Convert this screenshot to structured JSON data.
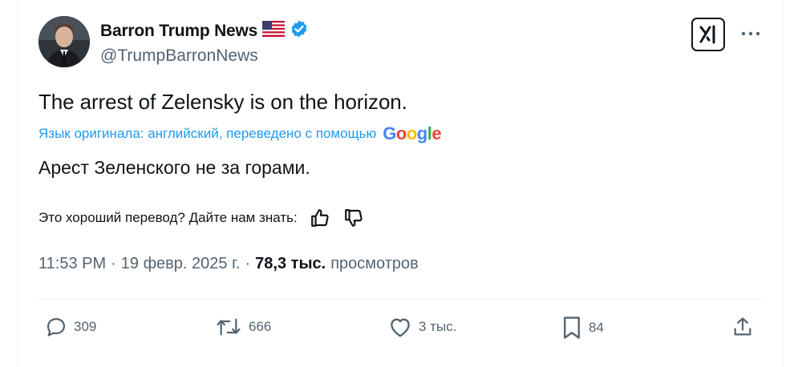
{
  "author": {
    "name": "Barron Trump News",
    "flag_emoji": "🇺🇸",
    "verified": true,
    "handle": "@TrumpBarronNews"
  },
  "tweet": {
    "text": "The arrest of Zelensky is on the horizon.",
    "translation_note": "Язык оригинала: английский, переведено с помощью",
    "translation_provider": "Google",
    "translated_text": "Арест Зеленского не за горами."
  },
  "feedback": {
    "question": "Это хороший перевод? Дайте нам знать:"
  },
  "meta": {
    "time": "11:53 PM",
    "separator": "·",
    "date": "19 февр. 2025 г.",
    "views_count": "78,3 тыс.",
    "views_label": "просмотров"
  },
  "actions": {
    "replies": "309",
    "reposts": "666",
    "likes": "3 тыс.",
    "bookmarks": "84"
  },
  "colors": {
    "accent": "#1d9bf0",
    "text_primary": "#0f1419",
    "text_secondary": "#536471",
    "divider": "#eff3f4"
  }
}
